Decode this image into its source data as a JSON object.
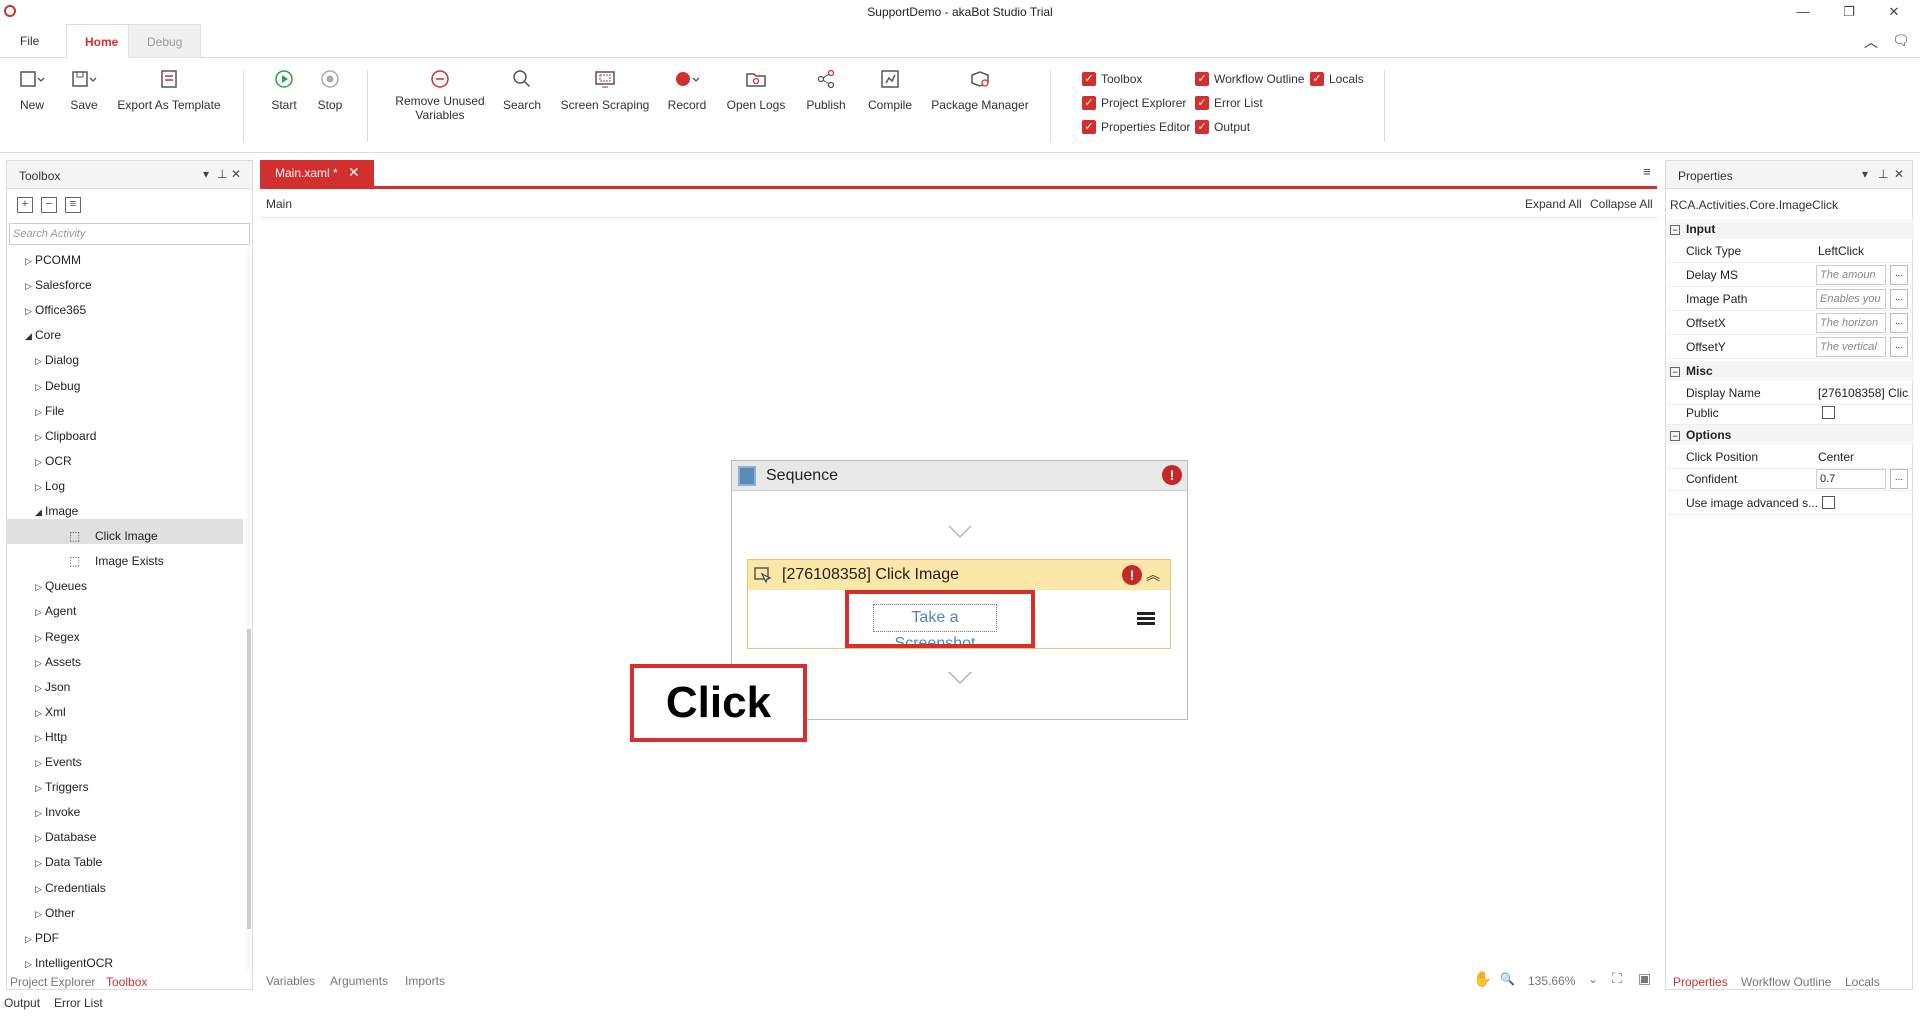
{
  "window": {
    "title": "SupportDemo - akaBot Studio Trial",
    "controls": [
      "minimize-icon",
      "restore-icon",
      "close-icon"
    ]
  },
  "menu_tabs": [
    {
      "label": "File",
      "state": "normal"
    },
    {
      "label": "Home",
      "state": "active"
    },
    {
      "label": "Debug",
      "state": "disabled"
    }
  ],
  "ribbon": {
    "buttons": {
      "new": "New",
      "save": "Save",
      "export_template": "Export As Template",
      "start": "Start",
      "stop": "Stop",
      "remove_unused_1": "Remove Unused",
      "remove_unused_2": "Variables",
      "search": "Search",
      "screen_scraping": "Screen Scraping",
      "record": "Record",
      "open_logs": "Open Logs",
      "publish": "Publish",
      "compile": "Compile",
      "package_manager": "Package Manager"
    },
    "toggles": {
      "toolbox": "Toolbox",
      "project_explorer": "Project Explorer",
      "properties_editor": "Properties Editor",
      "workflow_outline": "Workflow Outline",
      "error_list": "Error List",
      "output": "Output",
      "locals": "Locals"
    }
  },
  "toolbox": {
    "title": "Toolbox",
    "search_placeholder": "Search Activity",
    "items": [
      {
        "label": "PCOMM",
        "level": 1,
        "expanded": false
      },
      {
        "label": "Salesforce",
        "level": 1,
        "expanded": false
      },
      {
        "label": "Office365",
        "level": 1,
        "expanded": false
      },
      {
        "label": "Core",
        "level": 1,
        "expanded": true
      },
      {
        "label": "Dialog",
        "level": 2,
        "expanded": false
      },
      {
        "label": "Debug",
        "level": 2,
        "expanded": false
      },
      {
        "label": "File",
        "level": 2,
        "expanded": false
      },
      {
        "label": "Clipboard",
        "level": 2,
        "expanded": false
      },
      {
        "label": "OCR",
        "level": 2,
        "expanded": false
      },
      {
        "label": "Log",
        "level": 2,
        "expanded": false
      },
      {
        "label": "Image",
        "level": 2,
        "expanded": true
      },
      {
        "label": "Click Image",
        "level": 3,
        "selected": true
      },
      {
        "label": "Image Exists",
        "level": 3
      },
      {
        "label": "Queues",
        "level": 2,
        "expanded": false
      },
      {
        "label": "Agent",
        "level": 2,
        "expanded": false
      },
      {
        "label": "Regex",
        "level": 2,
        "expanded": false
      },
      {
        "label": "Assets",
        "level": 2,
        "expanded": false
      },
      {
        "label": "Json",
        "level": 2,
        "expanded": false
      },
      {
        "label": "Xml",
        "level": 2,
        "expanded": false
      },
      {
        "label": "Http",
        "level": 2,
        "expanded": false
      },
      {
        "label": "Events",
        "level": 2,
        "expanded": false
      },
      {
        "label": "Triggers",
        "level": 2,
        "expanded": false
      },
      {
        "label": "Invoke",
        "level": 2,
        "expanded": false
      },
      {
        "label": "Database",
        "level": 2,
        "expanded": false
      },
      {
        "label": "Data Table",
        "level": 2,
        "expanded": false
      },
      {
        "label": "Credentials",
        "level": 2,
        "expanded": false
      },
      {
        "label": "Other",
        "level": 2,
        "expanded": false
      },
      {
        "label": "PDF",
        "level": 1,
        "expanded": false
      },
      {
        "label": "IntelligentOCR",
        "level": 1,
        "expanded": false
      }
    ],
    "bottom_tabs": [
      {
        "label": "Project Explorer",
        "active": false
      },
      {
        "label": "Toolbox",
        "active": true
      },
      {
        "label": "Output",
        "active": false
      },
      {
        "label": "Error List",
        "active": false
      }
    ]
  },
  "document": {
    "tab_label": "Main.xaml *",
    "breadcrumb": "Main",
    "expand_all": "Expand All",
    "collapse_all": "Collapse All",
    "sequence_title": "Sequence",
    "activity_title": "[276108358] Click Image",
    "screenshot_link": "Take a Screenshot",
    "annotation": "Click",
    "bottom_tabs": [
      "Variables",
      "Arguments",
      "Imports"
    ],
    "zoom": "135.66%"
  },
  "properties": {
    "title": "Properties",
    "type": "RCA.Activities.Core.ImageClick",
    "categories": {
      "input": "Input",
      "misc": "Misc",
      "options": "Options"
    },
    "rows": {
      "click_type": {
        "name": "Click Type",
        "value": "LeftClick"
      },
      "delay_ms": {
        "name": "Delay MS",
        "placeholder": "The amoun"
      },
      "image_path": {
        "name": "Image Path",
        "placeholder": "Enables you"
      },
      "offset_x": {
        "name": "OffsetX",
        "placeholder": "The horizon"
      },
      "offset_y": {
        "name": "OffsetY",
        "placeholder": "The vertical"
      },
      "display_name": {
        "name": "Display Name",
        "value": "[276108358] Clic"
      },
      "public": {
        "name": "Public"
      },
      "click_position": {
        "name": "Click Position",
        "value": "Center"
      },
      "confident": {
        "name": "Confident",
        "value": "0.7"
      },
      "advanced": {
        "name": "Use image advanced s..."
      }
    },
    "bottom_tabs": [
      {
        "label": "Properties",
        "active": true
      },
      {
        "label": "Workflow Outline",
        "active": false
      },
      {
        "label": "Locals",
        "active": false
      }
    ]
  },
  "colors": {
    "accent": "#d32f2f",
    "activity_header": "#fbe7a7",
    "error": "#c62828",
    "link": "#4a86c8"
  }
}
